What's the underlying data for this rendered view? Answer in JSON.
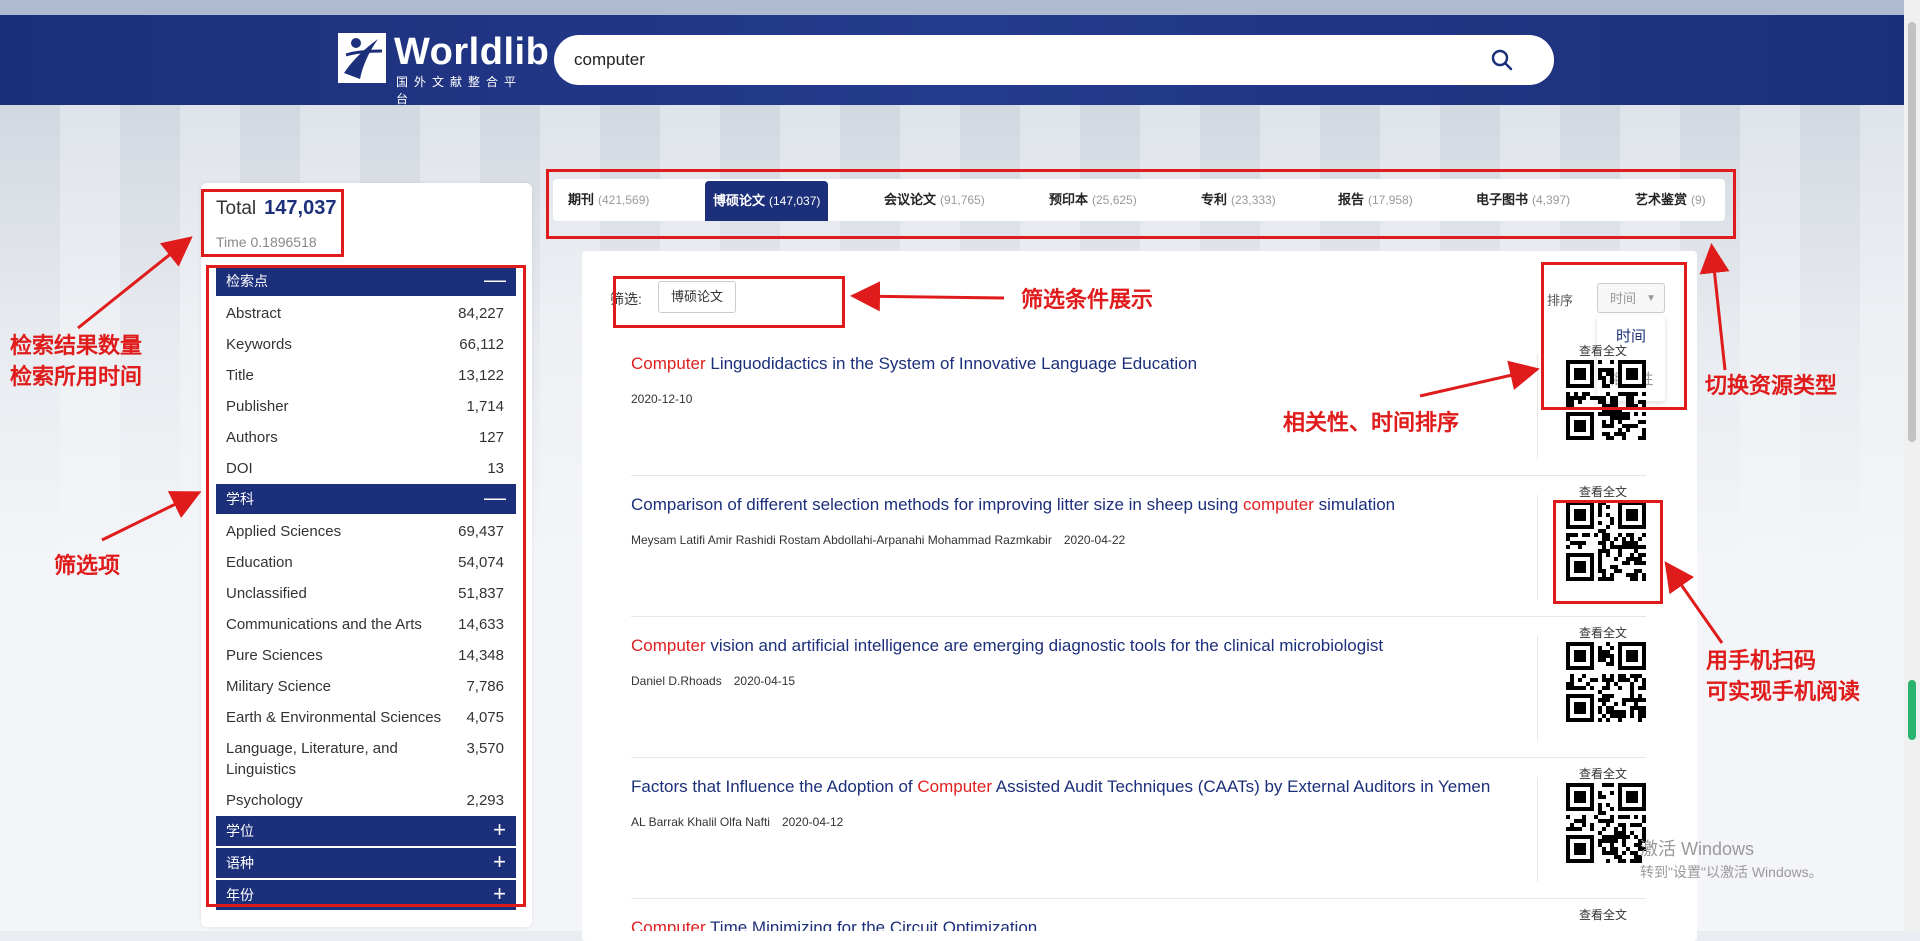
{
  "header": {
    "logo_name": "Worldlib",
    "logo_sub": "国外文献整合平台",
    "search_query": "computer",
    "search_icon": "search-icon"
  },
  "stats": {
    "total_label": "Total",
    "total_value": "147,037",
    "time_text": "Time 0.1896518"
  },
  "facets": {
    "search_point": {
      "title": "检索点",
      "items": [
        {
          "label": "Abstract",
          "count": "84,227"
        },
        {
          "label": "Keywords",
          "count": "66,112"
        },
        {
          "label": "Title",
          "count": "13,122"
        },
        {
          "label": "Publisher",
          "count": "1,714"
        },
        {
          "label": "Authors",
          "count": "127"
        },
        {
          "label": "DOI",
          "count": "13"
        }
      ]
    },
    "subject": {
      "title": "学科",
      "items": [
        {
          "label": "Applied Sciences",
          "count": "69,437"
        },
        {
          "label": "Education",
          "count": "54,074"
        },
        {
          "label": "Unclassified",
          "count": "51,837"
        },
        {
          "label": "Communications and the Arts",
          "count": "14,633"
        },
        {
          "label": "Pure Sciences",
          "count": "14,348"
        },
        {
          "label": "Military Science",
          "count": "7,786"
        },
        {
          "label": "Earth & Environmental Sciences",
          "count": "4,075"
        },
        {
          "label": "Language, Literature, and Linguistics",
          "count": "3,570"
        },
        {
          "label": "Psychology",
          "count": "2,293"
        }
      ]
    },
    "collapsed": [
      "学位",
      "语种",
      "年份"
    ],
    "minus_sign": "—",
    "plus_sign": "+"
  },
  "tabs": [
    {
      "label": "期刊",
      "count": "(421,569)"
    },
    {
      "label": "博硕论文",
      "count": "(147,037)"
    },
    {
      "label": "会议论文",
      "count": "(91,765)"
    },
    {
      "label": "预印本",
      "count": "(25,625)"
    },
    {
      "label": "专利",
      "count": "(23,333)"
    },
    {
      "label": "报告",
      "count": "(17,958)"
    },
    {
      "label": "电子图书",
      "count": "(4,397)"
    },
    {
      "label": "艺术鉴赏",
      "count": "(9)"
    }
  ],
  "filter": {
    "label": "筛选:",
    "chip": "博硕论文"
  },
  "sort": {
    "label": "排序",
    "selected": "时间",
    "options": [
      "时间",
      "相关性"
    ]
  },
  "results": [
    {
      "title_parts": [
        "Computer",
        " Linguodidactics in the System of Innovative Language Education"
      ],
      "authors": "",
      "date": "2020-12-10",
      "view_label": "查看全文"
    },
    {
      "title_parts": [
        "Comparison of different selection methods for improving litter size in sheep using ",
        "computer",
        " simulation"
      ],
      "authors": "Meysam Latifi Amir Rashidi Rostam Abdollahi-Arpanahi Mohammad Razmkabir",
      "date": "2020-04-22",
      "view_label": "查看全文"
    },
    {
      "title_parts": [
        "Computer",
        " vision and artificial intelligence are emerging diagnostic tools for the clinical microbiologist"
      ],
      "authors": "Daniel D.Rhoads",
      "date": "2020-04-15",
      "view_label": "查看全文"
    },
    {
      "title_parts": [
        "Factors that Influence the Adoption of ",
        "Computer",
        " Assisted Audit Techniques (CAATs) by External Auditors in Yemen"
      ],
      "authors": "AL Barrak Khalil Olfa Nafti",
      "date": "2020-04-12",
      "view_label": "查看全文"
    },
    {
      "title_parts": [
        "Computer",
        " Time Minimizing for the Circuit Optimization"
      ],
      "authors": "",
      "date": "",
      "view_label": "查看全文"
    }
  ],
  "annotations": {
    "result_count_line1": "检索结果数量",
    "result_count_line2": "检索所用时间",
    "filter_options": "筛选项",
    "filter_display": "筛选条件展示",
    "switch_type": "切换资源类型",
    "sort_note": "相关性、时间排序",
    "mobile_line1": "用手机扫码",
    "mobile_line2": "可实现手机阅读",
    "color": "#e01b1b"
  },
  "windows_watermark": {
    "line1": "激活 Windows",
    "line2": "转到\"设置\"以激活 Windows。"
  },
  "colors": {
    "brand": "#1c2f7a",
    "highlight": "#e02020"
  }
}
